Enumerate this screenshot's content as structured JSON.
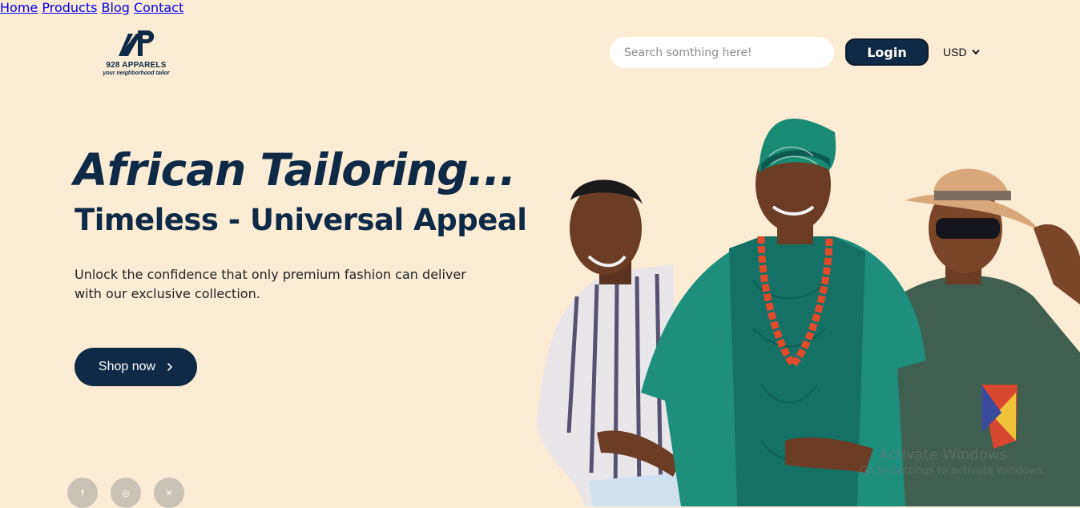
{
  "brand": {
    "name": "928 APPARELS",
    "tagline": "your neighborhood tailor"
  },
  "nav": {
    "items": [
      {
        "label": "Home"
      },
      {
        "label": "Products"
      },
      {
        "label": "Blog"
      },
      {
        "label": "Contact"
      }
    ]
  },
  "search": {
    "placeholder": "Search somthing here!",
    "value": ""
  },
  "header": {
    "login_label": "Login",
    "currency": "USD"
  },
  "hero": {
    "title": "African Tailoring...",
    "subtitle": "Timeless - Universal Appeal",
    "description": "Unlock the confidence that only premium fashion can deliver with our exclusive collection.",
    "cta_label": "Shop now"
  },
  "socials": [
    {
      "icon": "facebook-icon",
      "glyph": "f"
    },
    {
      "icon": "instagram-icon",
      "glyph": "◎"
    },
    {
      "icon": "x-icon",
      "glyph": "✕"
    }
  ],
  "os_watermark": {
    "line1": "Activate Windows",
    "line2": "Go to Settings to activate Windows."
  },
  "colors": {
    "background": "#fcecd4",
    "primary": "#0e2a47",
    "agbada_green": "#1f8f7d"
  }
}
